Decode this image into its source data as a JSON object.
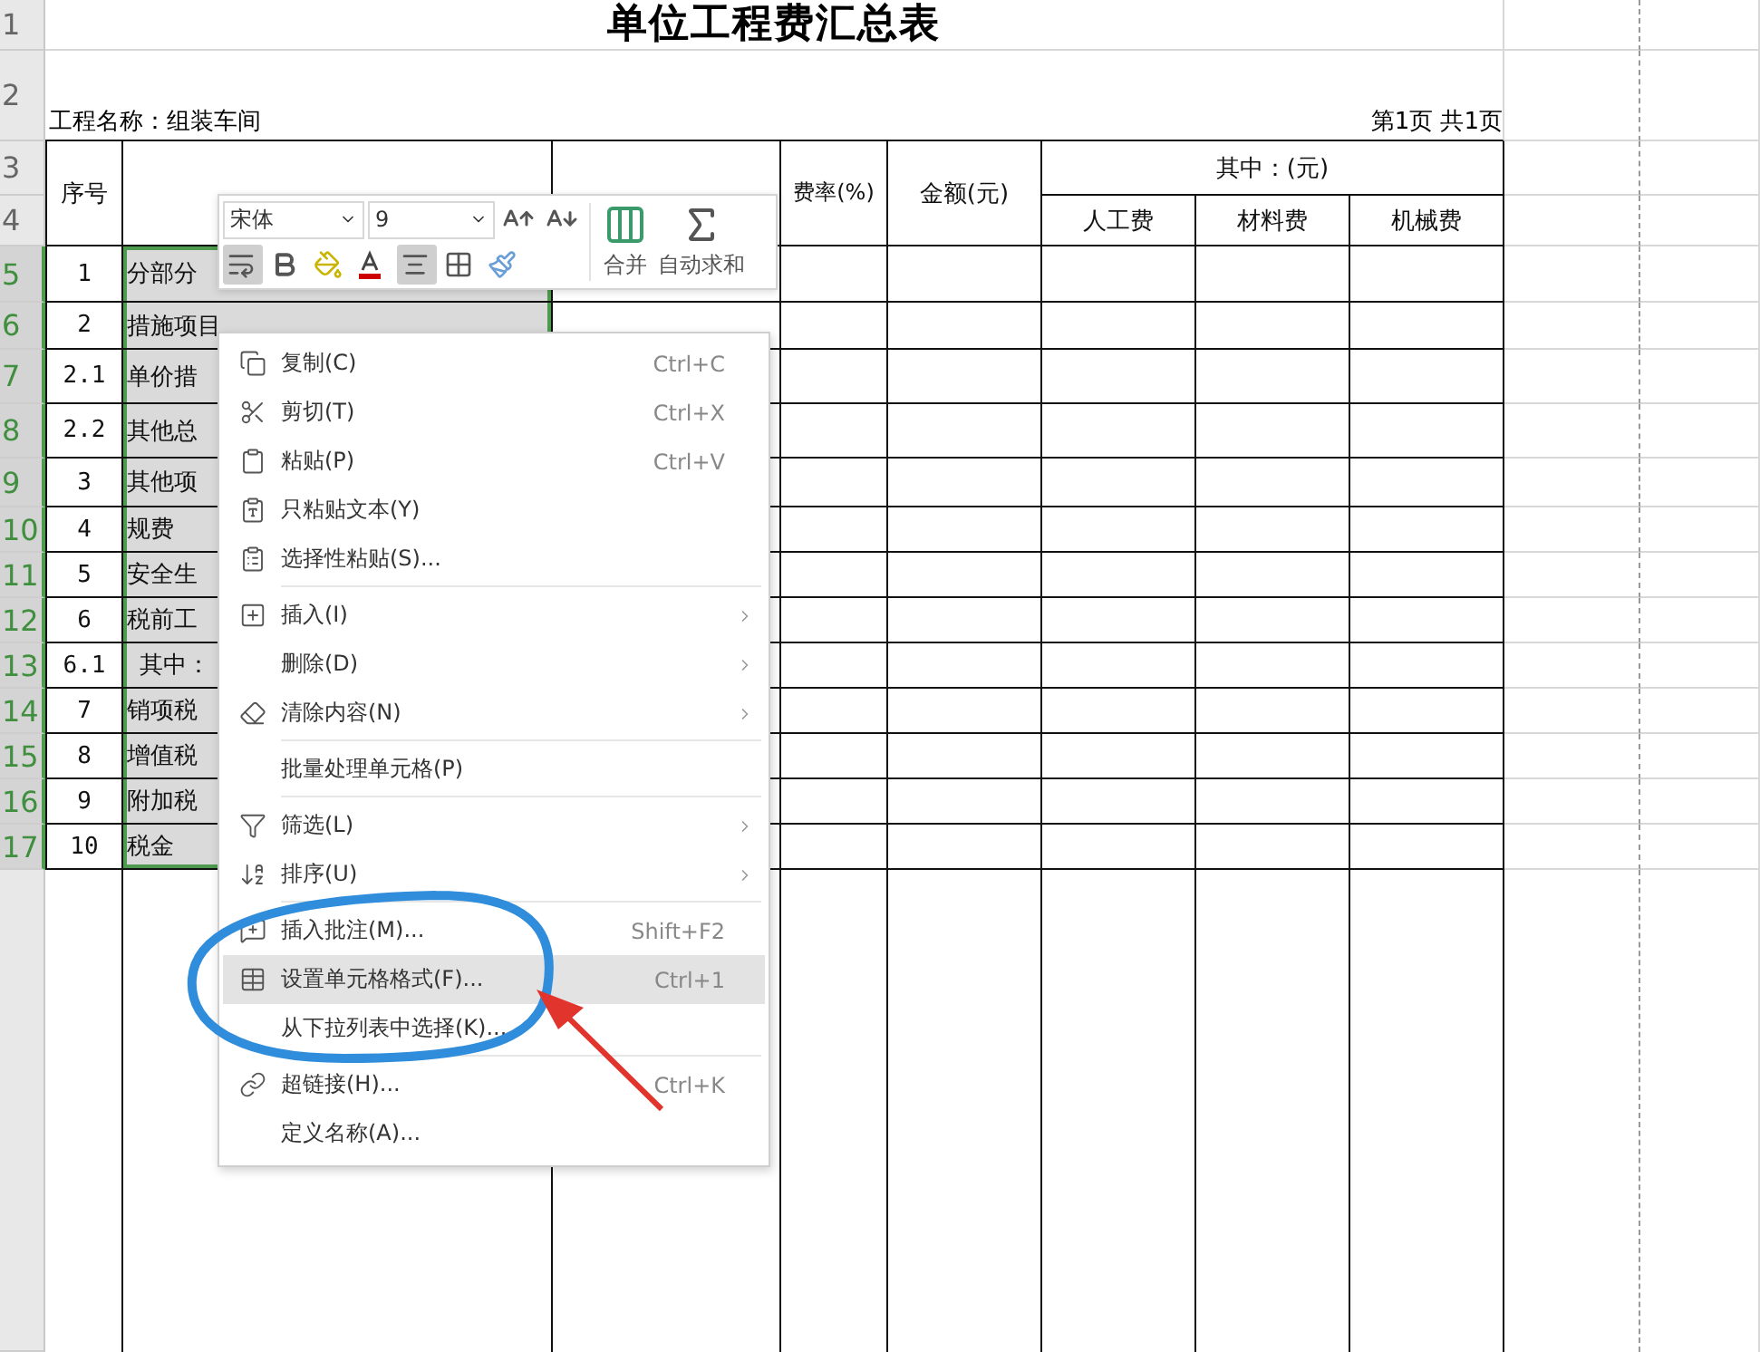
{
  "sheet": {
    "title": "单位工程费汇总表",
    "project": "工程名称：组装车间",
    "page": "第1页 共1页",
    "row_numbers": [
      "1",
      "2",
      "3",
      "4"
    ],
    "headers": {
      "seq": "序号",
      "rate": "费率(%)",
      "amount": "金额(元)",
      "of_which": "其中：(元)",
      "sub": [
        "人工费",
        "材料费",
        "机械费"
      ]
    },
    "rows": [
      {
        "row_number": "5",
        "no": "1",
        "name": "分部分",
        "selected": true,
        "indent": false
      },
      {
        "row_number": "6",
        "no": "2",
        "name": "措施项目",
        "selected": true,
        "indent": false
      },
      {
        "row_number": "7",
        "no": "2.1",
        "name": "单价措",
        "selected": true,
        "indent": false
      },
      {
        "row_number": "8",
        "no": "2.2",
        "name": "其他总",
        "selected": true,
        "indent": false
      },
      {
        "row_number": "9",
        "no": "3",
        "name": "其他项",
        "selected": true,
        "indent": false
      },
      {
        "row_number": "10",
        "no": "4",
        "name": "规费",
        "selected": true,
        "indent": false
      },
      {
        "row_number": "11",
        "no": "5",
        "name": "安全生",
        "selected": true,
        "indent": false
      },
      {
        "row_number": "12",
        "no": "6",
        "name": "税前工",
        "selected": true,
        "indent": false
      },
      {
        "row_number": "13",
        "no": "6.1",
        "name": "其中：",
        "selected": true,
        "indent": true
      },
      {
        "row_number": "14",
        "no": "7",
        "name": "销项税",
        "selected": true,
        "indent": false
      },
      {
        "row_number": "15",
        "no": "8",
        "name": "增值税",
        "selected": true,
        "indent": false
      },
      {
        "row_number": "16",
        "no": "9",
        "name": "附加税",
        "selected": true,
        "indent": false
      },
      {
        "row_number": "17",
        "no": "10",
        "name": "税金",
        "selected": true,
        "indent": false
      }
    ]
  },
  "mini_toolbar": {
    "font": "宋体",
    "size": "9",
    "merge": "合并",
    "autosum": "自动求和",
    "buttons": [
      {
        "kind": "wrap",
        "on": true
      },
      {
        "kind": "bold",
        "on": false
      },
      {
        "kind": "fill",
        "on": false
      },
      {
        "kind": "font_color",
        "on": false
      },
      {
        "kind": "align",
        "on": true
      },
      {
        "kind": "border",
        "on": false
      },
      {
        "kind": "painter",
        "on": false
      }
    ]
  },
  "context_menu": {
    "items": [
      {
        "kind": "item",
        "label": "复制(C)",
        "shortcut": "Ctrl+C",
        "submenu": false,
        "selected": false
      },
      {
        "kind": "item",
        "label": "剪切(T)",
        "shortcut": "Ctrl+X",
        "submenu": false,
        "selected": false
      },
      {
        "kind": "item",
        "label": "粘贴(P)",
        "shortcut": "Ctrl+V",
        "submenu": false,
        "selected": false
      },
      {
        "kind": "item",
        "label": "只粘贴文本(Y)",
        "submenu": false,
        "selected": false
      },
      {
        "kind": "item",
        "label": "选择性粘贴(S)...",
        "submenu": false,
        "selected": false
      },
      {
        "kind": "separator"
      },
      {
        "kind": "item",
        "label": "插入(I)",
        "submenu": true,
        "selected": false
      },
      {
        "kind": "item",
        "label": "删除(D)",
        "submenu": true,
        "selected": false
      },
      {
        "kind": "item",
        "label": "清除内容(N)",
        "submenu": true,
        "selected": false
      },
      {
        "kind": "separator"
      },
      {
        "kind": "item",
        "label": "批量处理单元格(P)",
        "submenu": false,
        "selected": false
      },
      {
        "kind": "separator"
      },
      {
        "kind": "item",
        "label": "筛选(L)",
        "submenu": true,
        "selected": false
      },
      {
        "kind": "item",
        "label": "排序(U)",
        "submenu": true,
        "selected": false
      },
      {
        "kind": "separator"
      },
      {
        "kind": "item",
        "label": "插入批注(M)...",
        "shortcut": "Shift+F2",
        "submenu": false,
        "selected": false
      },
      {
        "kind": "item",
        "label": "设置单元格格式(F)...",
        "shortcut": "Ctrl+1",
        "submenu": false,
        "selected": true
      },
      {
        "kind": "item",
        "label": "从下拉列表中选择(K)...",
        "submenu": false,
        "selected": false
      },
      {
        "kind": "separator"
      },
      {
        "kind": "item",
        "label": "超链接(H)...",
        "shortcut": "Ctrl+K",
        "submenu": false,
        "selected": false
      },
      {
        "kind": "item",
        "label": "定义名称(A)...",
        "submenu": false,
        "selected": false
      }
    ]
  }
}
